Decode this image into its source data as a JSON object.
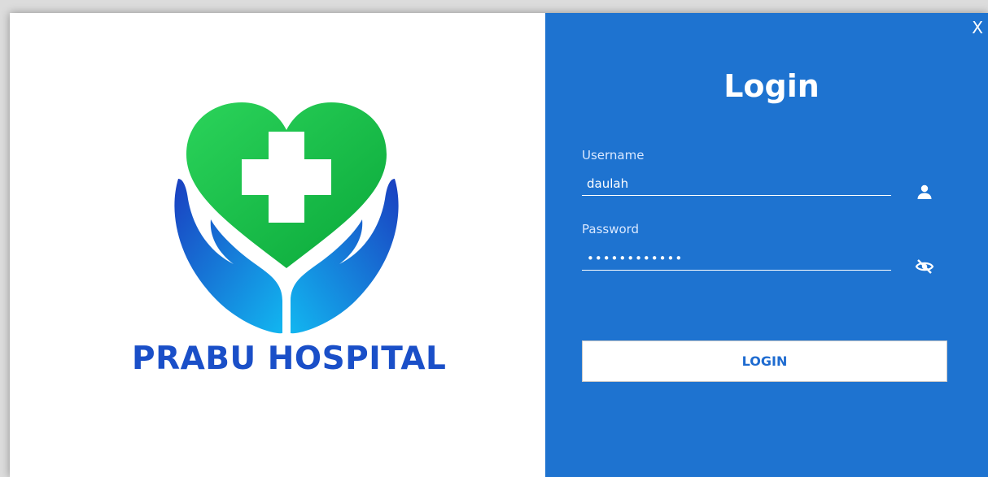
{
  "window": {
    "close_label": "X"
  },
  "brand": {
    "name": "PRABU HOSPITAL"
  },
  "login": {
    "title": "Login",
    "username_label": "Username",
    "username_value": "daulah",
    "password_label": "Password",
    "password_value": "••••••••••••",
    "button_label": "LOGIN"
  },
  "colors": {
    "panel": "#1e73d0",
    "brand_text": "#1a4fc8",
    "heart": "#19c054"
  },
  "icons": {
    "username": "user-icon",
    "password": "eye-off-icon",
    "logo": "heart-cross-hands-icon"
  }
}
